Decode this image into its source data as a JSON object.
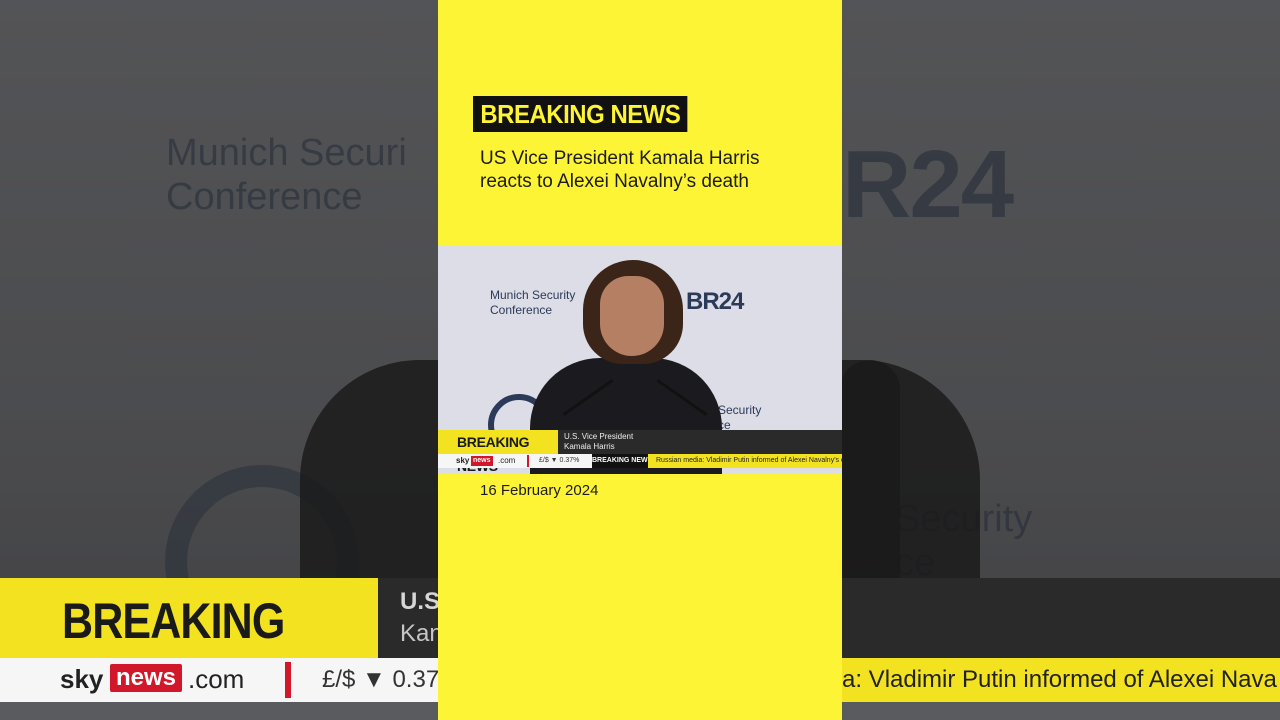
{
  "badge": "BREAKING NEWS",
  "headline": "US Vice President Kamala Harris reacts to Alexei Navalny’s death",
  "date": "16 February 2024",
  "backdrop": {
    "conference_line1": "Munich Securi",
    "conference_line2": "Conference",
    "broadcaster": "R24",
    "security_line1": "Security",
    "security_line2": "ce"
  },
  "video": {
    "conference_line1": "Munich Security",
    "conference_line2": "Conference",
    "broadcaster": "BR24",
    "security_line1": "Security",
    "security_line2": "ce"
  },
  "lower_third": {
    "label": "BREAKING NEWS",
    "title": "U.S. Vice President",
    "name": "Kamala Harris",
    "bg_title": "U.S",
    "bg_name": "Kan"
  },
  "ticker": {
    "sky": "sky",
    "news": "news",
    "com": ".com",
    "fx": "£/$ ▼ 0.37%",
    "bg_fx": "£/$ ▼ 0.37",
    "label": "BREAKING NEWS",
    "story": "Russian media: Vladimir Putin informed of Alexei Navalny's death",
    "bg_story": "a: Vladimir Putin informed of Alexei Nava"
  },
  "colors": {
    "panel_yellow": "#fef436",
    "sky_red": "#d3172b",
    "badge_black": "#111111"
  }
}
